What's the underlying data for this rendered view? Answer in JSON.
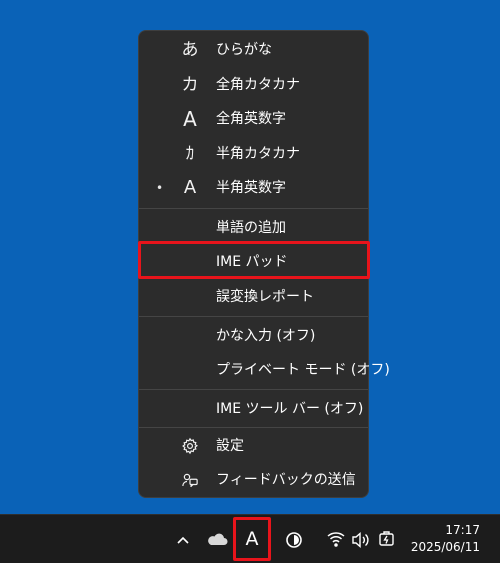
{
  "menu": {
    "items": [
      {
        "icon": "hiragana-a-icon",
        "glyph": "あ",
        "label": "ひらがな",
        "selected": false
      },
      {
        "icon": "katakana-ka-icon",
        "glyph": "カ",
        "label": "全角カタカナ",
        "selected": false
      },
      {
        "icon": "fullwidth-a-icon",
        "glyph": "A",
        "label": "全角英数字",
        "selected": false
      },
      {
        "icon": "halfwidth-katakana-icon",
        "glyph": "ｶ",
        "label": "半角カタカナ",
        "selected": false
      },
      {
        "icon": "halfwidth-a-icon",
        "glyph": "A",
        "label": "半角英数字",
        "selected": true,
        "bullet": "•"
      },
      {
        "label": "単語の追加"
      },
      {
        "label": "IME パッド"
      },
      {
        "label": "誤変換レポート"
      },
      {
        "label": "かな入力 (オフ)"
      },
      {
        "label": "プライベート モード (オフ)"
      },
      {
        "label": "IME ツール バー (オフ)"
      },
      {
        "icon": "gear-icon",
        "label": "設定"
      },
      {
        "icon": "feedback-icon",
        "label": "フィードバックの送信"
      }
    ]
  },
  "taskbar": {
    "ime_indicator": "A",
    "time": "17:17",
    "date": "2025/06/11",
    "icons": [
      "chevron-up-icon",
      "onedrive-cloud-icon",
      "ime-indicator",
      "focus-clock-icon",
      "wifi-icon",
      "volume-icon",
      "battery-icon"
    ]
  },
  "colors": {
    "desktop": "#0a62b7",
    "menu_bg": "#2c2c2c",
    "taskbar_bg": "#1c1c1c",
    "highlight_border": "#e8141b"
  }
}
